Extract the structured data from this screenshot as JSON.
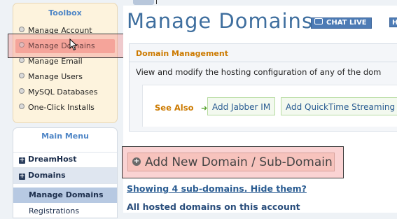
{
  "toolbox": {
    "title": "Toolbox",
    "items": [
      {
        "label": "Manage Account"
      },
      {
        "label": "Manage Domains",
        "active": true
      },
      {
        "label": "Manage Email"
      },
      {
        "label": "Manage Users"
      },
      {
        "label": "MySQL Databases"
      },
      {
        "label": "One-Click Installs"
      }
    ]
  },
  "main_menu": {
    "title": "Main Menu",
    "sections": [
      {
        "label": "DreamHost",
        "icon": "plus-icon"
      },
      {
        "label": "Domains",
        "icon": "plus-icon"
      }
    ],
    "sub_items": [
      {
        "label": "Manage Domains",
        "selected": true
      },
      {
        "label": "Registrations"
      }
    ]
  },
  "header": {
    "title": "Manage Domains",
    "chat_label": "CHAT LIVE",
    "help_label": "H"
  },
  "panel": {
    "title": "Domain Management",
    "description": "View and modify the hosting configuration of any of the dom",
    "see_also": "See Also",
    "links": [
      {
        "label": "Add Jabber IM"
      },
      {
        "label": "Add QuickTime Streaming"
      }
    ]
  },
  "actions": {
    "add_domain": "Add New Domain / Sub-Domain",
    "show_subdomains": "Showing 4 sub-domains. Hide them?",
    "all_hosted": "All hosted domains on this account"
  },
  "colors": {
    "accent_blue": "#4f86c6",
    "title_blue": "#3e6e9e",
    "orange": "#cc7a00",
    "highlight_red": "#f7b7a8"
  }
}
